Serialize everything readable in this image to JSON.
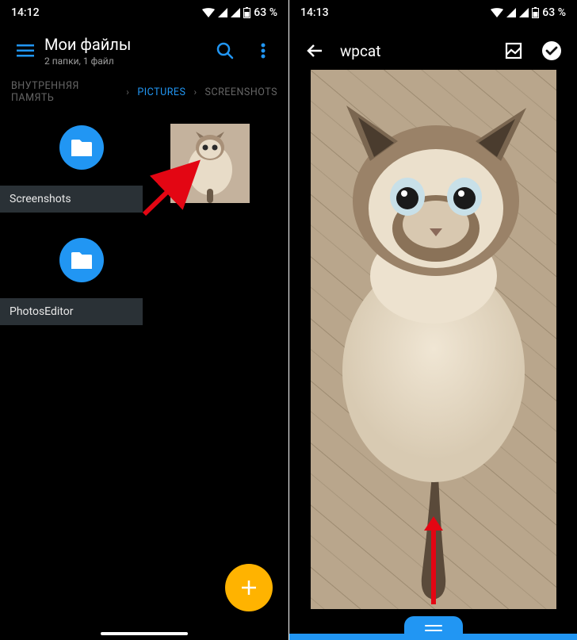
{
  "left": {
    "status": {
      "time": "14:12",
      "battery": "63 %"
    },
    "title": "Мои файлы",
    "subtitle": "2 папки, 1 файл",
    "breadcrumb": {
      "items": [
        {
          "label": "ВНУТРЕННЯЯ ПАМЯТЬ",
          "active": false
        },
        {
          "label": "PICTURES",
          "active": true
        },
        {
          "label": "SCREENSHOTS",
          "active": false
        }
      ]
    },
    "folders": [
      {
        "label": "Screenshots"
      },
      {
        "label": "PhotosEditor"
      }
    ]
  },
  "right": {
    "status": {
      "time": "14:13",
      "battery": "63 %"
    },
    "title": "wpcat"
  },
  "colors": {
    "accent": "#2196f3",
    "fab": "#ffb300",
    "arrow": "#e30613"
  }
}
